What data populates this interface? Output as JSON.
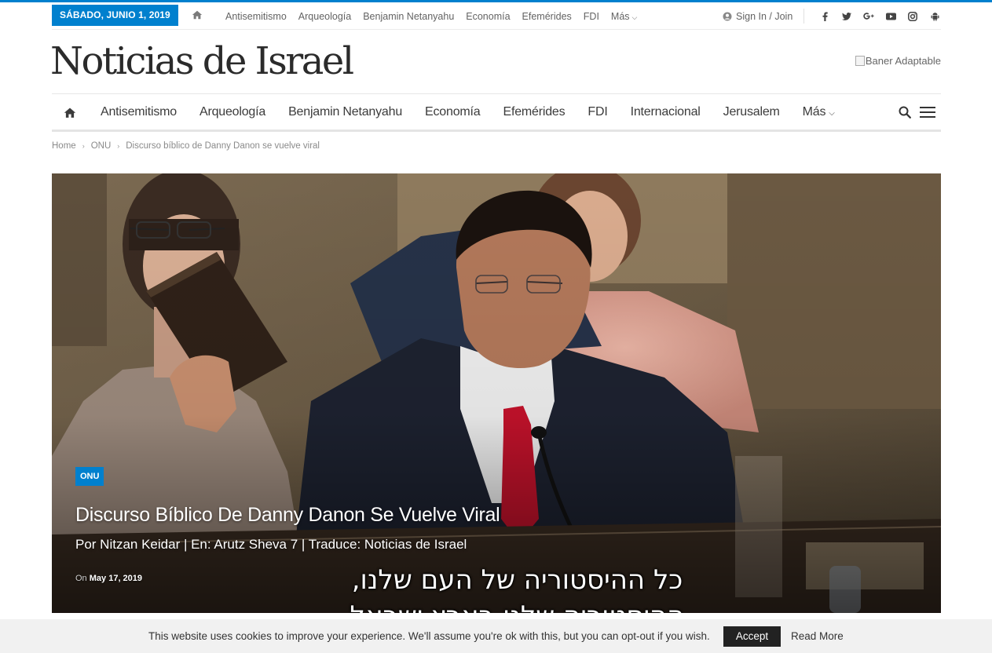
{
  "colors": {
    "accent": "#0080ce",
    "cookie_bar": "#f1f1f1",
    "accept_button": "#222222"
  },
  "topbar": {
    "date": "SÁBADO, JUNIO 1, 2019",
    "home_icon": "home-icon",
    "menu": [
      "Antisemitismo",
      "Arqueología",
      "Benjamin Netanyahu",
      "Economía",
      "Efemérides",
      "FDI",
      "Más"
    ],
    "signin": "Sign In / Join",
    "socials": [
      "facebook-icon",
      "twitter-icon",
      "google-plus-icon",
      "youtube-icon",
      "instagram-icon",
      "android-icon"
    ]
  },
  "header": {
    "logo": "Noticias de Israel",
    "banner_alt": "Baner Adaptable"
  },
  "mainnav": {
    "items": [
      "Antisemitismo",
      "Arqueología",
      "Benjamin Netanyahu",
      "Economía",
      "Efemérides",
      "FDI",
      "Internacional",
      "Jerusalem",
      "Más"
    ]
  },
  "breadcrumb": [
    "Home",
    "ONU",
    "Discurso bíblico de Danny Danon se vuelve viral"
  ],
  "hero": {
    "category": "ONU",
    "title": "Discurso Bíblico De Danny Danon Se Vuelve Viral",
    "subtitle": "Por Nitzan Keidar | En: Arutz Sheva 7 | Traduce: Noticias de Israel",
    "meta_prefix": "On",
    "date": "May 17, 2019",
    "caption_line1": "כל ההיסטוריה של העם שלנו,",
    "caption_line2": "ההיסטוריה שלנו בארץ ישראל"
  },
  "cookie": {
    "message": "This website uses cookies to improve your experience. We'll assume you're ok with this, but you can opt-out if you wish.",
    "accept": "Accept",
    "read_more": "Read More"
  }
}
